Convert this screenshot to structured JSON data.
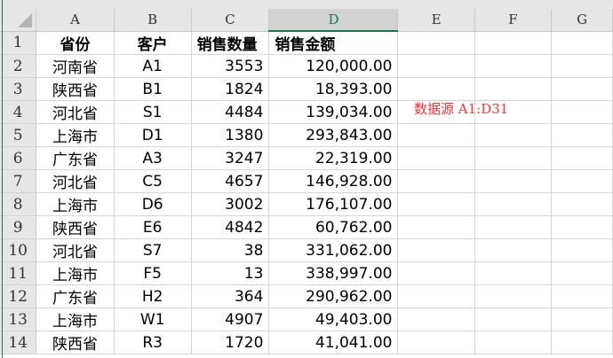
{
  "columns": [
    "A",
    "B",
    "C",
    "D",
    "E",
    "F",
    "G"
  ],
  "header": [
    "省份",
    "客户",
    "销售数量",
    "销售金额"
  ],
  "rows": [
    [
      "河南省",
      "A1",
      "3553",
      "120,000.00"
    ],
    [
      "陕西省",
      "B1",
      "1824",
      "18,393.00"
    ],
    [
      "河北省",
      "S1",
      "4484",
      "139,034.00"
    ],
    [
      "上海市",
      "D1",
      "1380",
      "293,843.00"
    ],
    [
      "广东省",
      "A3",
      "3247",
      "22,319.00"
    ],
    [
      "河北省",
      "C5",
      "4657",
      "146,928.00"
    ],
    [
      "上海市",
      "D6",
      "3002",
      "176,107.00"
    ],
    [
      "陕西省",
      "E6",
      "4842",
      "60,762.00"
    ],
    [
      "河北省",
      "S7",
      "38",
      "331,062.00"
    ],
    [
      "上海市",
      "F5",
      "13",
      "338,997.00"
    ],
    [
      "广东省",
      "H2",
      "364",
      "290,962.00"
    ],
    [
      "上海市",
      "W1",
      "4907",
      "49,403.00"
    ],
    [
      "陕西省",
      "R3",
      "1720",
      "41,041.00"
    ]
  ],
  "row_numbers": [
    "1",
    "2",
    "3",
    "4",
    "5",
    "6",
    "7",
    "8",
    "9",
    "10",
    "11",
    "12",
    "13",
    "14"
  ],
  "note": "数据源 A1:D31",
  "colors": {
    "accent": "#217346",
    "note": "#ff3333"
  }
}
